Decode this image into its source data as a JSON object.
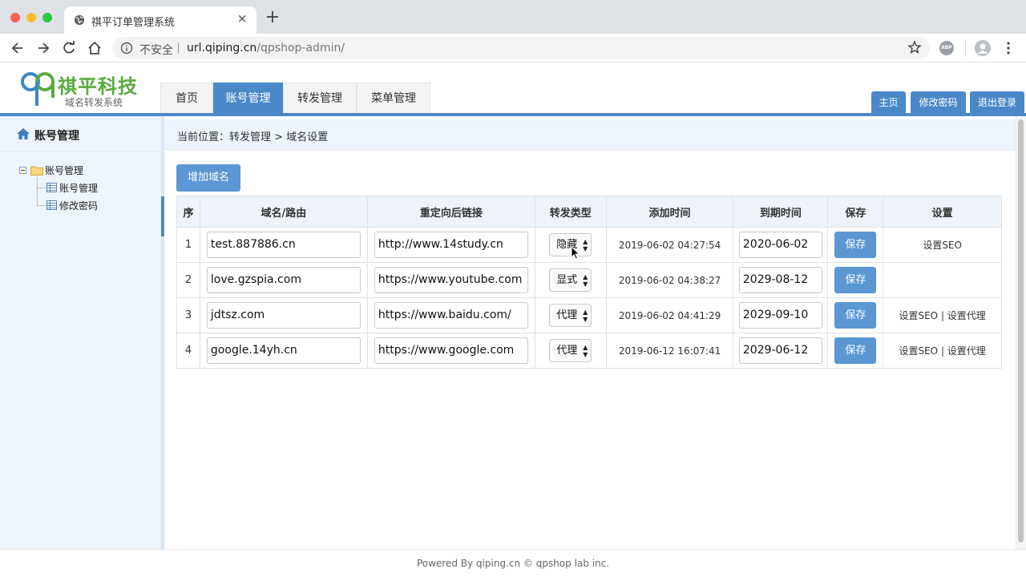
{
  "browser": {
    "tab_title": "祺平订单管理系统",
    "tab_close": "×",
    "new_tab": "+",
    "insecure_label": "不安全",
    "url_host": "url.qiping.cn",
    "url_path": "/qpshop-admin/",
    "abp_label": "ABP"
  },
  "header": {
    "logo_title": "祺平科技",
    "logo_subtitle": "域名转发系统",
    "nav": [
      {
        "label": "首页",
        "active": false
      },
      {
        "label": "账号管理",
        "active": true
      },
      {
        "label": "转发管理",
        "active": false
      },
      {
        "label": "菜单管理",
        "active": false
      }
    ],
    "right_nav": {
      "home": "主页",
      "change_password": "修改密码",
      "logout": "退出登录"
    },
    "accent_color": "#4a89c9"
  },
  "sidebar": {
    "title": "账号管理",
    "tree": {
      "root": "账号管理",
      "children": [
        "账号管理",
        "修改密码"
      ]
    }
  },
  "content": {
    "breadcrumb": "当前位置：转发管理 > 域名设置",
    "add_button": "增加域名",
    "table": {
      "headers": [
        "序",
        "域名/路由",
        "重定向后链接",
        "转发类型",
        "添加时间",
        "到期时间",
        "保存",
        "设置"
      ],
      "rows": [
        {
          "index": "1",
          "domain": "test.887886.cn",
          "redirect": "http://www.14study.cn",
          "type": "隐藏",
          "added": "2019-06-02 04:27:54",
          "expires": "2020-06-02",
          "save": "保存",
          "link_seo": "设置SEO",
          "sep": "",
          "link_proxy": ""
        },
        {
          "index": "2",
          "domain": "love.gzspia.com",
          "redirect": "https://www.youtube.com",
          "type": "显式",
          "added": "2019-06-02 04:38:27",
          "expires": "2029-08-12",
          "save": "保存",
          "link_seo": "",
          "sep": "",
          "link_proxy": ""
        },
        {
          "index": "3",
          "domain": "jdtsz.com",
          "redirect": "https://www.baidu.com/",
          "type": "代理",
          "added": "2019-06-02 04:41:29",
          "expires": "2029-09-10",
          "save": "保存",
          "link_seo": "设置SEO",
          "sep": " | ",
          "link_proxy": "设置代理"
        },
        {
          "index": "4",
          "domain": "google.14yh.cn",
          "redirect": "https://www.google.com",
          "type": "代理",
          "added": "2019-06-12 16:07:41",
          "expires": "2029-06-12",
          "save": "保存",
          "link_seo": "设置SEO",
          "sep": " | ",
          "link_proxy": "设置代理"
        }
      ]
    }
  },
  "footer": {
    "text": "Powered By qiping.cn © qpshop lab inc."
  }
}
